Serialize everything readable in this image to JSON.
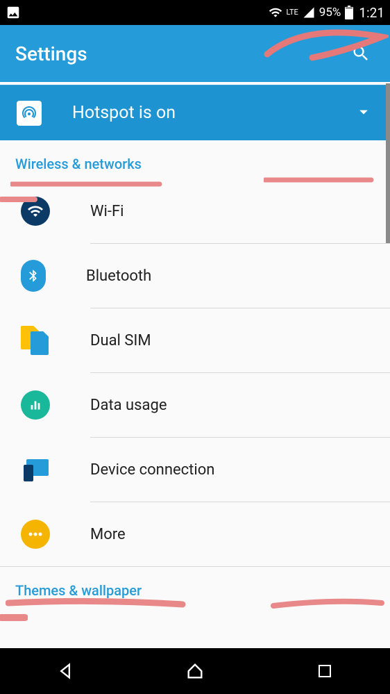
{
  "status_bar": {
    "network_label": "LTE",
    "battery_percent": "95%",
    "time": "1:21"
  },
  "header": {
    "title": "Settings"
  },
  "hotspot_banner": {
    "text": "Hotspot is on"
  },
  "sections": {
    "wireless": {
      "title": "Wireless & networks",
      "items": [
        {
          "label": "Wi-Fi"
        },
        {
          "label": "Bluetooth"
        },
        {
          "label": "Dual SIM"
        },
        {
          "label": "Data usage"
        },
        {
          "label": "Device connection"
        },
        {
          "label": "More"
        }
      ]
    },
    "themes": {
      "title": "Themes & wallpaper"
    }
  },
  "colors": {
    "accent": "#259cd9",
    "header_bg": "#259cd9",
    "banner_bg": "#1d94d1"
  }
}
